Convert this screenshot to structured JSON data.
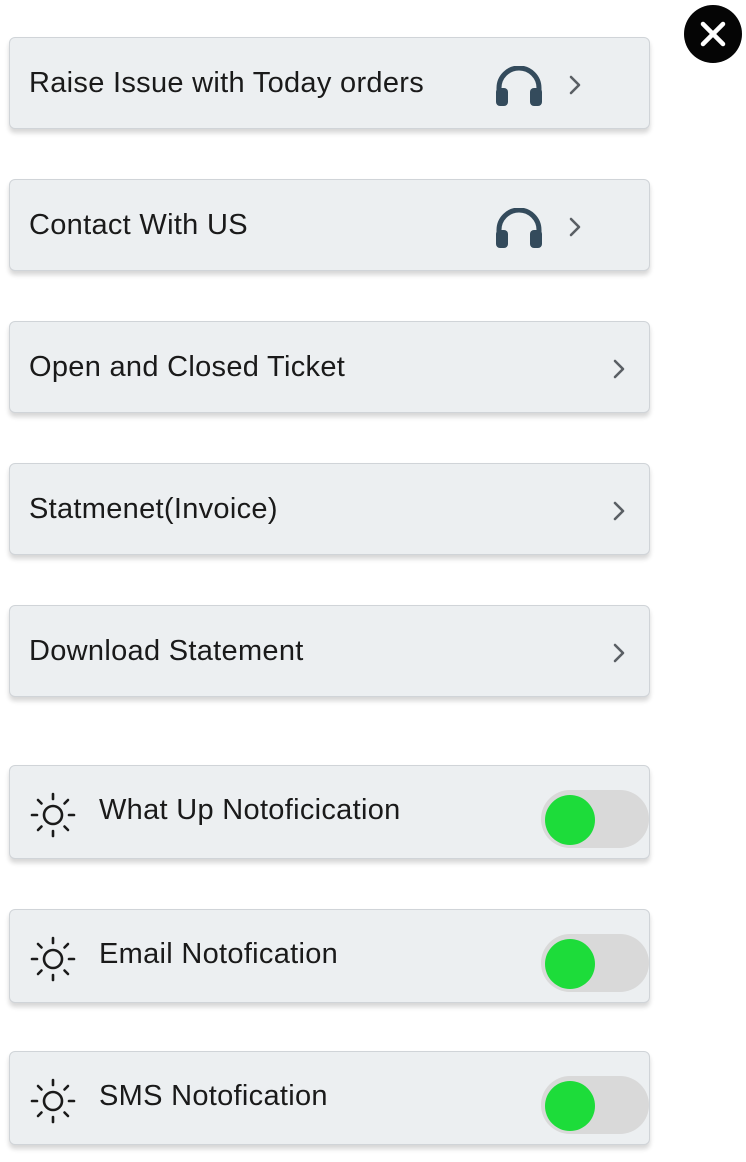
{
  "menu": [
    {
      "label": "Raise Issue with Today orders",
      "icon": "headset-icon",
      "has_icon": true
    },
    {
      "label": "Contact With US",
      "icon": "headset-icon",
      "has_icon": true
    },
    {
      "label": "Open and Closed Ticket",
      "has_icon": false
    },
    {
      "label": "Statmenet(Invoice)",
      "has_icon": false
    },
    {
      "label": "Download Statement",
      "has_icon": false
    }
  ],
  "notifications": [
    {
      "label": "What Up Notoficication",
      "icon": "sun-icon",
      "enabled": true
    },
    {
      "label": "Email Notofication",
      "icon": "sun-icon",
      "enabled": true
    },
    {
      "label": "SMS Notofication",
      "icon": "sun-icon",
      "enabled": true
    }
  ],
  "colors": {
    "card_background": "#eceff1",
    "toggle_on": "#1ddc3a",
    "toggle_track": "#d9d9d9",
    "headset_icon": "#344b5c",
    "close_button": "#050505"
  }
}
